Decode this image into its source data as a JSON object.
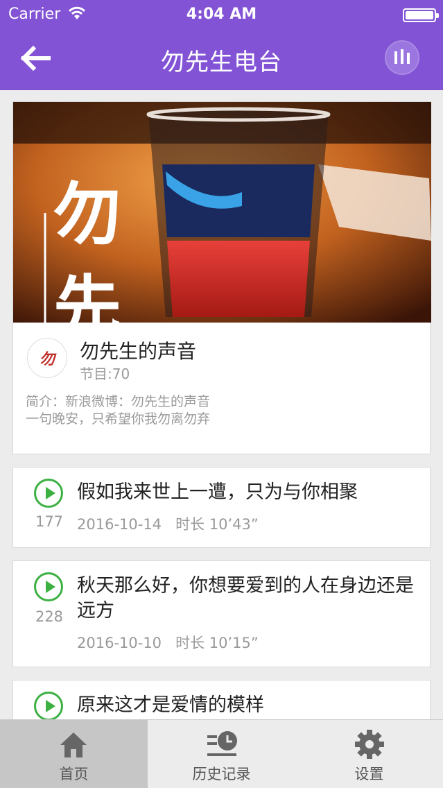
{
  "status_bar": {
    "carrier": "Carrier",
    "time": "4:04 AM"
  },
  "nav": {
    "title": "勿先生电台",
    "back_icon": "back-arrow-icon",
    "player_icon": "equalizer-icon"
  },
  "channel": {
    "banner_text": "勿先",
    "logo_text": "勿",
    "title": "勿先生的声音",
    "count": "节目:70",
    "desc_line1": "简介：新浪微博：勿先生的声音",
    "desc_line2": "一句晚安，只希望你我勿离勿弃"
  },
  "episodes": [
    {
      "title": "假如我来世上一遭，只为与你相聚",
      "plays": "177",
      "date": "2016-10-14",
      "duration": "时长 10’43”"
    },
    {
      "title": "秋天那么好，你想要爱到的人在身边还是远方",
      "plays": "228",
      "date": "2016-10-10",
      "duration": "时长 10’15”"
    },
    {
      "title": "原来这才是爱情的模样",
      "plays": "",
      "date": "",
      "duration": ""
    }
  ],
  "tabs": [
    {
      "label": "首页",
      "icon": "home-icon"
    },
    {
      "label": "历史记录",
      "icon": "history-icon"
    },
    {
      "label": "设置",
      "icon": "gear-icon"
    }
  ],
  "colors": {
    "brand": "#8353d6",
    "play_green": "#3cb043"
  }
}
